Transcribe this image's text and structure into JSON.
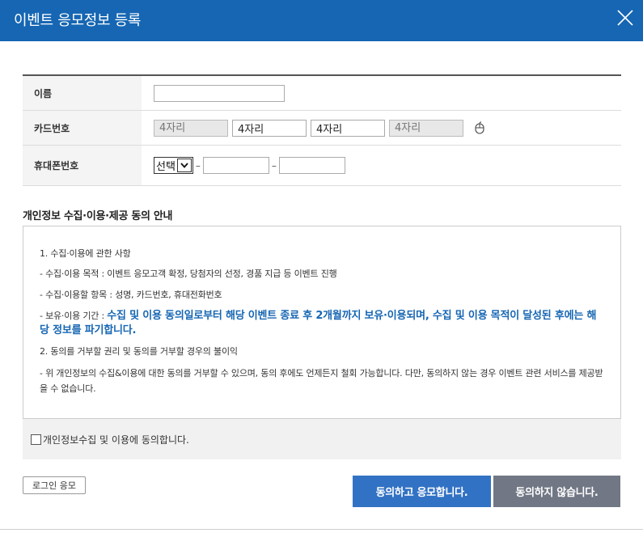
{
  "window": {
    "title": "이벤트 응모정보 등록",
    "header_color": "#1666b3"
  },
  "form": {
    "name": {
      "label": "이름",
      "value": "",
      "placeholder": ""
    },
    "card": {
      "label": "카드번호",
      "fields": [
        {
          "value": "",
          "placeholder": "4자리",
          "disabled": true
        },
        {
          "value": "4자리",
          "placeholder": "",
          "disabled": false
        },
        {
          "value": "4자리",
          "placeholder": "",
          "disabled": false
        },
        {
          "value": "",
          "placeholder": "4자리",
          "disabled": true
        }
      ],
      "icon": "mouse-icon"
    },
    "phone": {
      "label": "휴대폰번호",
      "select_value": "선택",
      "separator": "–",
      "field2": "",
      "field3": ""
    }
  },
  "privacy": {
    "title": "개인정보 수집·이용·제공 동의 안내",
    "item1_title": "1. 수집·이용에 관한 사항",
    "purpose": "- 수집·이용 목적 : 이벤트 응모고객 확정, 당첨자의 선정, 경품 지급 등 이벤트 진행",
    "items": "- 수집·이용할 항목 : 성명, 카드번호, 휴대전화번호",
    "period_label": "- 보유·이용 기간 : ",
    "period_highlight": "수집 및 이용 동의일로부터 해당 이벤트 종료 후 2개월까지 보유·이용되며, 수집 및 이용 목적이 달성된 후에는 해당 정보를 파기합니다.",
    "item2_title": "2. 동의를 거부할 권리 및 동의를 거부할 경우의 불이익",
    "refuse_text": "- 위 개인정보의 수집&이용에 대한 동의를 거부할 수 있으며, 동의 후에도 언제든지 철회 가능합니다. 다만, 동의하지 않는 경우 이벤트 관련 서비스를 제공받을 수 없습니다.",
    "highlight_color": "#1666b3"
  },
  "agree_checkbox": {
    "label": "개인정보수집 및 이용에 동의합니다.",
    "checked": false
  },
  "buttons": {
    "login": "로그인 응모",
    "agree": "동의하고 응모합니다.",
    "disagree": "동의하지 않습니다."
  },
  "colors": {
    "agree_button": "#3272c4",
    "disagree_button": "#717784"
  }
}
